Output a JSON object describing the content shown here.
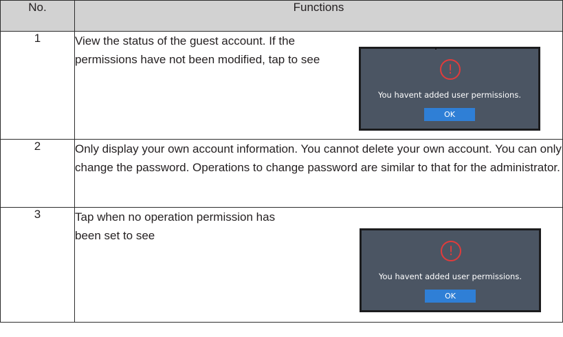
{
  "table": {
    "headers": {
      "no": "No.",
      "functions": "Functions"
    },
    "rows": [
      {
        "no": "1",
        "text": "View the status of the guest account. If the permissions have not been modified, tap to see",
        "dialog": {
          "message": "You havent added user permissions.",
          "button": "OK",
          "icon": "warning-circle-icon"
        }
      },
      {
        "no": "2",
        "text": "Only display your own account information. You cannot delete your own account. You can only change the password. Operations to change password are similar to that for the administrator."
      },
      {
        "no": "3",
        "text": "Tap when no operation permission has been set to see",
        "dialog": {
          "message": "You havent added user permissions.",
          "button": "OK",
          "icon": "warning-circle-icon"
        }
      }
    ]
  },
  "colors": {
    "header_bg": "#d2d2d2",
    "dialog_bg": "#4b5563",
    "dialog_button": "#2f7fd6",
    "warning_icon": "#e23b3b"
  }
}
